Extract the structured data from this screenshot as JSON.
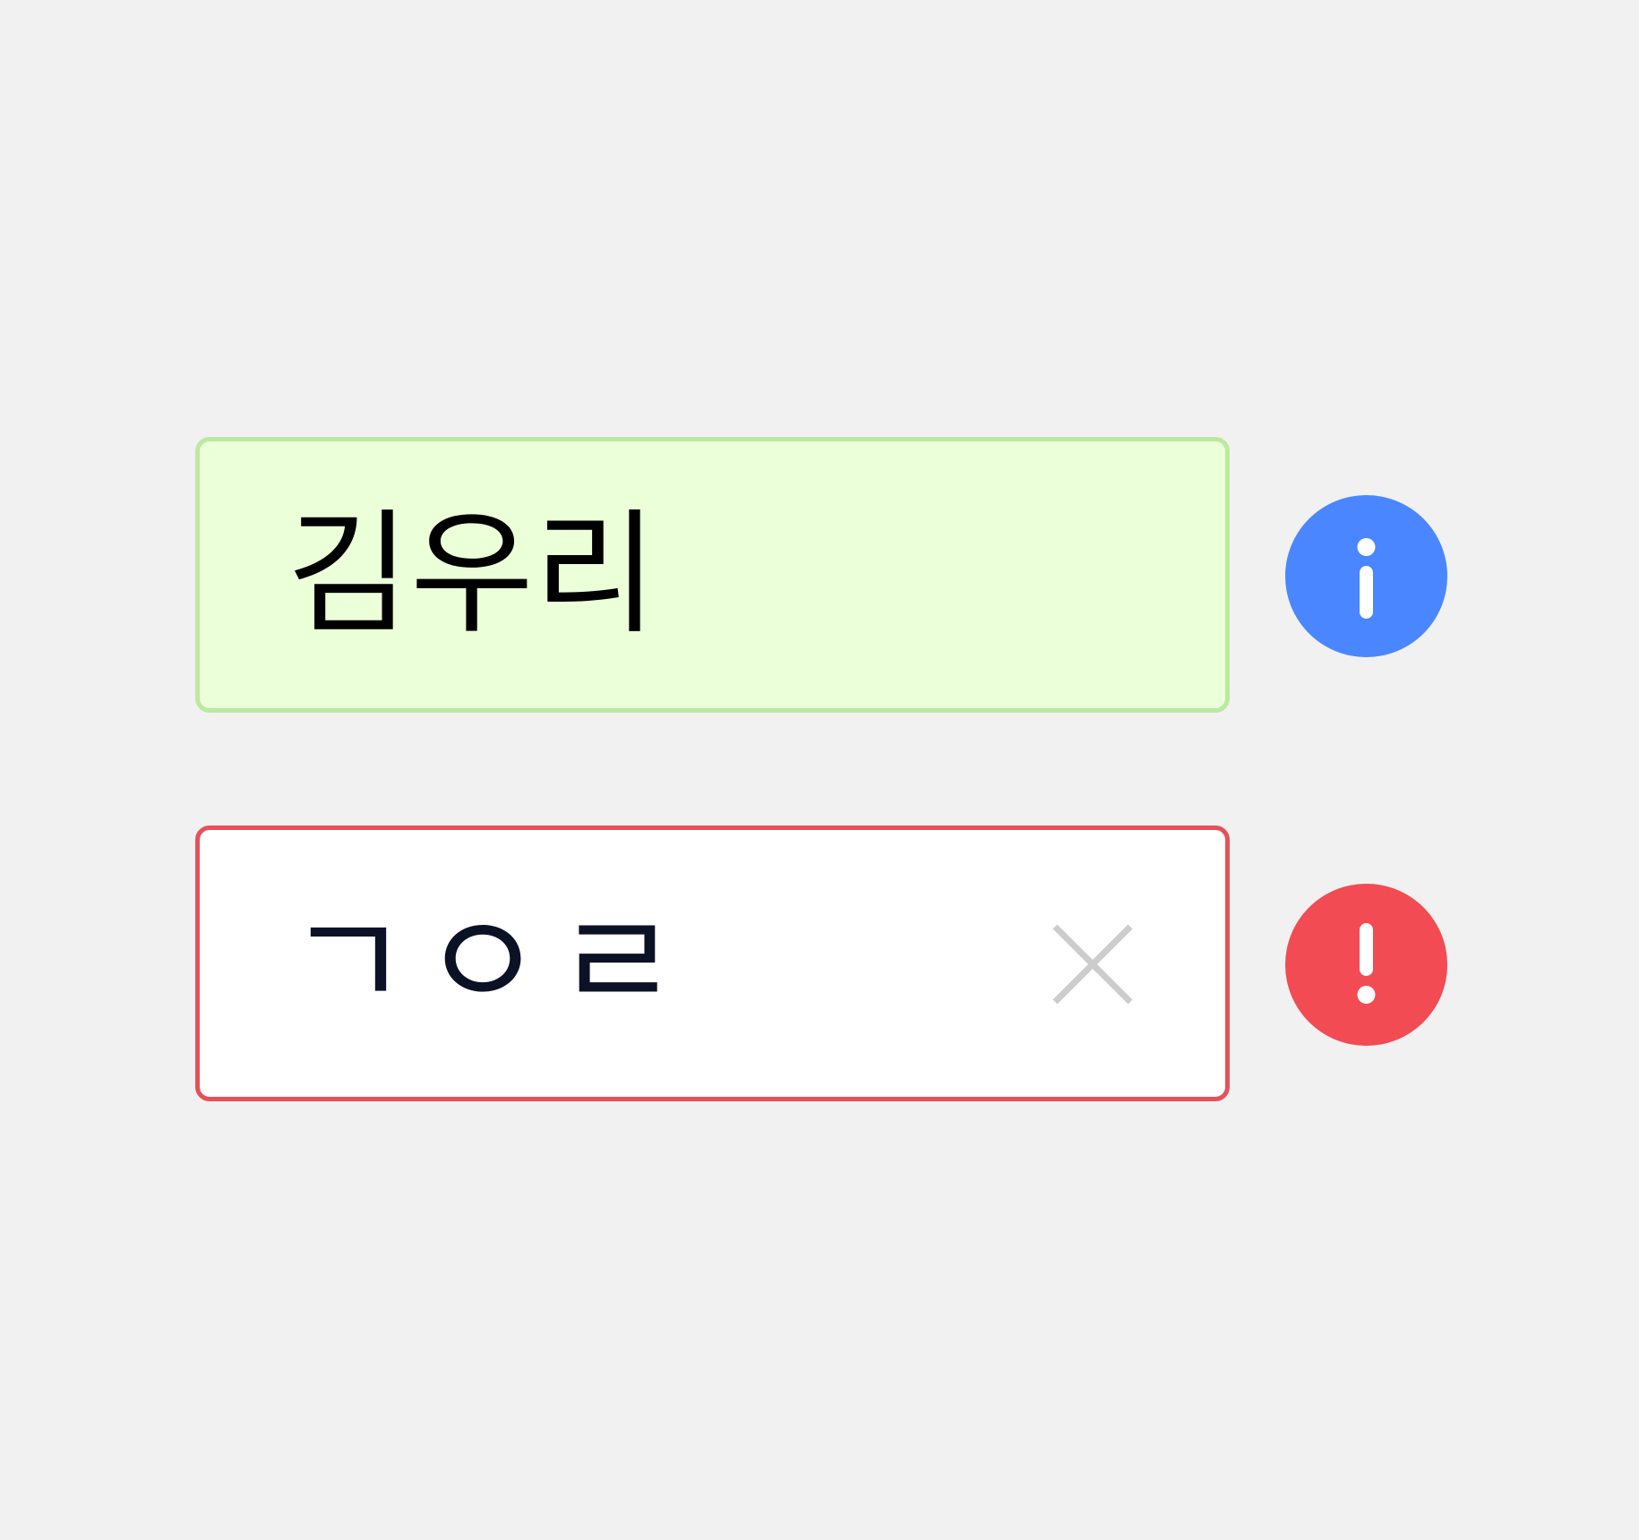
{
  "fields": [
    {
      "state": "valid",
      "value": "김우리",
      "status_icon": "info-icon",
      "status_color": "#4a86ff"
    },
    {
      "state": "invalid",
      "value": "ㄱㅇㄹ",
      "clear_icon": "close-icon",
      "status_icon": "error-icon",
      "status_color": "#f24b53"
    }
  ],
  "colors": {
    "page_background": "#f1f1f1",
    "valid_fill": "#ebffd9",
    "valid_border": "#bbe9a0",
    "invalid_fill": "#ffffff",
    "invalid_border": "#e6505a",
    "clear_icon": "#cccccc"
  }
}
